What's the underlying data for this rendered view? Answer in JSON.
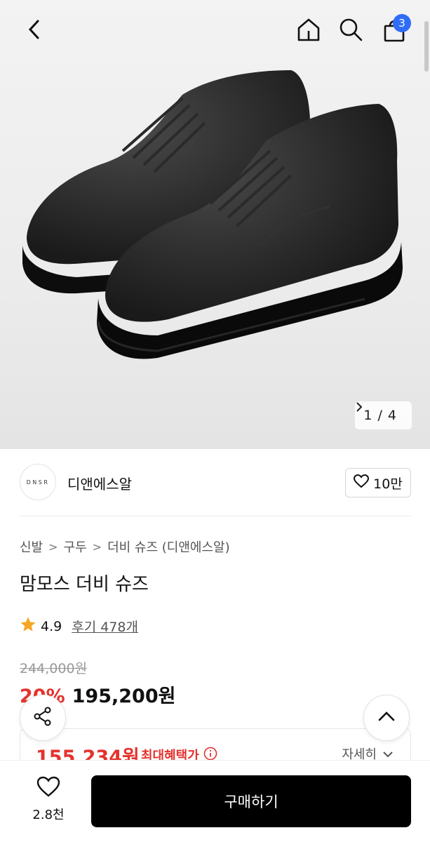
{
  "header": {
    "back_icon": "chevron-left-icon",
    "home_icon": "home-icon",
    "search_icon": "search-icon",
    "cart_icon": "shopping-bag-icon",
    "cart_count": "3"
  },
  "gallery": {
    "current": "1",
    "separator": "/",
    "total": "4",
    "next_icon": "chevron-right-icon"
  },
  "brand": {
    "logo_text": "DNSR",
    "name": "디앤에스알",
    "like_icon": "heart-icon",
    "like_count": "10만"
  },
  "breadcrumb": [
    "신발",
    "구두",
    "더비 슈즈 (디앤에스알)"
  ],
  "product": {
    "title": "맘모스 더비 슈즈",
    "rating": "4.9",
    "review_label": "후기 478개",
    "original_price": "244,000원",
    "discount": "20%",
    "sale_price": "195,200원"
  },
  "benefit": {
    "price": "155,234원",
    "label": "최대혜택가",
    "detail_label": "자세히"
  },
  "bottom": {
    "wish_count": "2.8천",
    "buy_label": "구매하기"
  },
  "colors": {
    "accent_red": "#e5322d",
    "badge_blue": "#2f6df6",
    "star": "#f5a623",
    "buy_button": "#000000"
  }
}
